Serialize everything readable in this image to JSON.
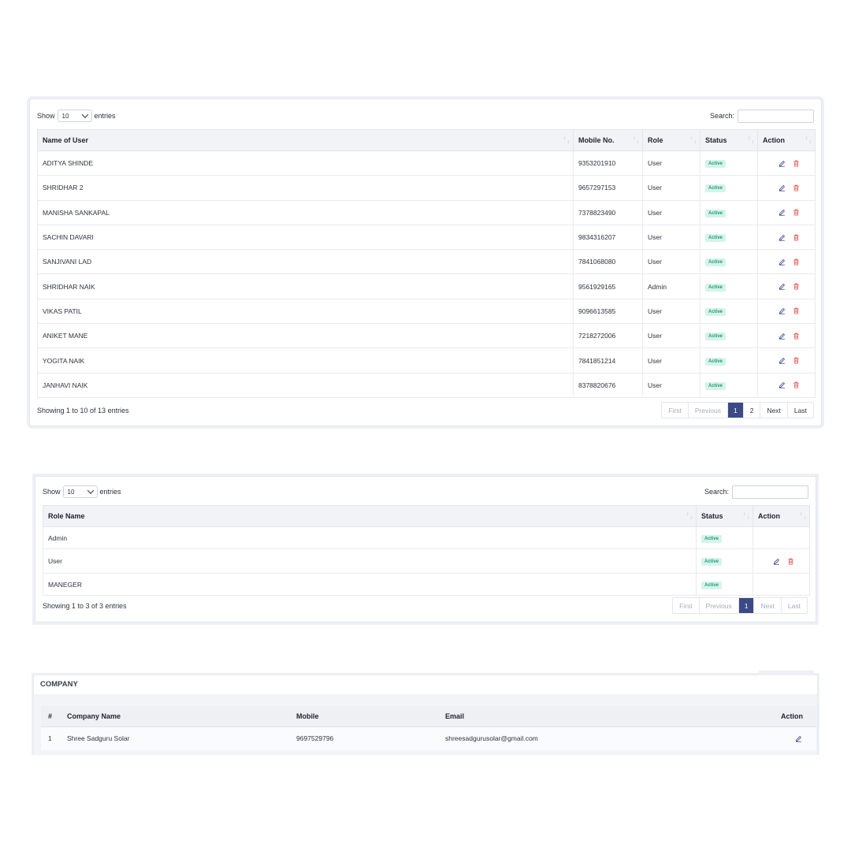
{
  "users_table": {
    "show_label": "Show",
    "entries_value": "10",
    "entries_label": "entries",
    "search_label": "Search:",
    "columns": [
      "Name of User",
      "Mobile No.",
      "Role",
      "Status",
      "Action"
    ],
    "rows": [
      {
        "name": "ADITYA SHINDE",
        "mobile": "9353201910",
        "role": "User",
        "status": "Active"
      },
      {
        "name": "SHRIDHAR 2",
        "mobile": "9657297153",
        "role": "User",
        "status": "Active"
      },
      {
        "name": "MANISHA SANKAPAL",
        "mobile": "7378823490",
        "role": "User",
        "status": "Active"
      },
      {
        "name": "SACHIN DAVARI",
        "mobile": "9834316207",
        "role": "User",
        "status": "Active"
      },
      {
        "name": "SANJIVANI LAD",
        "mobile": "7841068080",
        "role": "User",
        "status": "Active"
      },
      {
        "name": "SHRIDHAR NAIK",
        "mobile": "9561929165",
        "role": "Admin",
        "status": "Active"
      },
      {
        "name": "VIKAS PATIL",
        "mobile": "9096613585",
        "role": "User",
        "status": "Active"
      },
      {
        "name": "ANIKET MANE",
        "mobile": "7218272006",
        "role": "User",
        "status": "Active"
      },
      {
        "name": "YOGITA NAIK",
        "mobile": "7841851214",
        "role": "User",
        "status": "Active"
      },
      {
        "name": "JANHAVI NAIK",
        "mobile": "8378820676",
        "role": "User",
        "status": "Active"
      }
    ],
    "info": "Showing 1 to 10 of 13 entries",
    "pager": {
      "first": "First",
      "previous": "Previous",
      "page1": "1",
      "page2": "2",
      "next": "Next",
      "last": "Last"
    }
  },
  "roles_table": {
    "show_label": "Show",
    "entries_value": "10",
    "entries_label": "entries",
    "search_label": "Search:",
    "columns": [
      "Role Name",
      "Status",
      "Action"
    ],
    "rows": [
      {
        "name": "Admin",
        "status": "Active",
        "has_actions": false
      },
      {
        "name": "User",
        "status": "Active",
        "has_actions": true
      },
      {
        "name": "MANEGER",
        "status": "Active",
        "has_actions": false
      }
    ],
    "info": "Showing 1 to 3 of 3 entries",
    "pager": {
      "first": "First",
      "previous": "Previous",
      "page1": "1",
      "next": "Next",
      "last": "Last"
    }
  },
  "company": {
    "title": "COMPANY",
    "columns": [
      "#",
      "Company Name",
      "Mobile",
      "Email",
      "Action"
    ],
    "rows": [
      {
        "index": "1",
        "name": "Shree Sadguru Solar",
        "mobile": "9697529796",
        "email": "shreesadgurusolar@gmail.com"
      }
    ]
  },
  "colors": {
    "accent": "#3b4a85",
    "active_badge_bg": "#d6f3ea",
    "active_badge_text": "#1e9d78",
    "edit_icon": "#3b4a85",
    "delete_icon": "#e2574c"
  },
  "icons": {
    "edit": "pencil-icon",
    "delete": "trash-icon",
    "sort": "sort-arrows-icon",
    "dropdown": "chevron-down-icon"
  }
}
